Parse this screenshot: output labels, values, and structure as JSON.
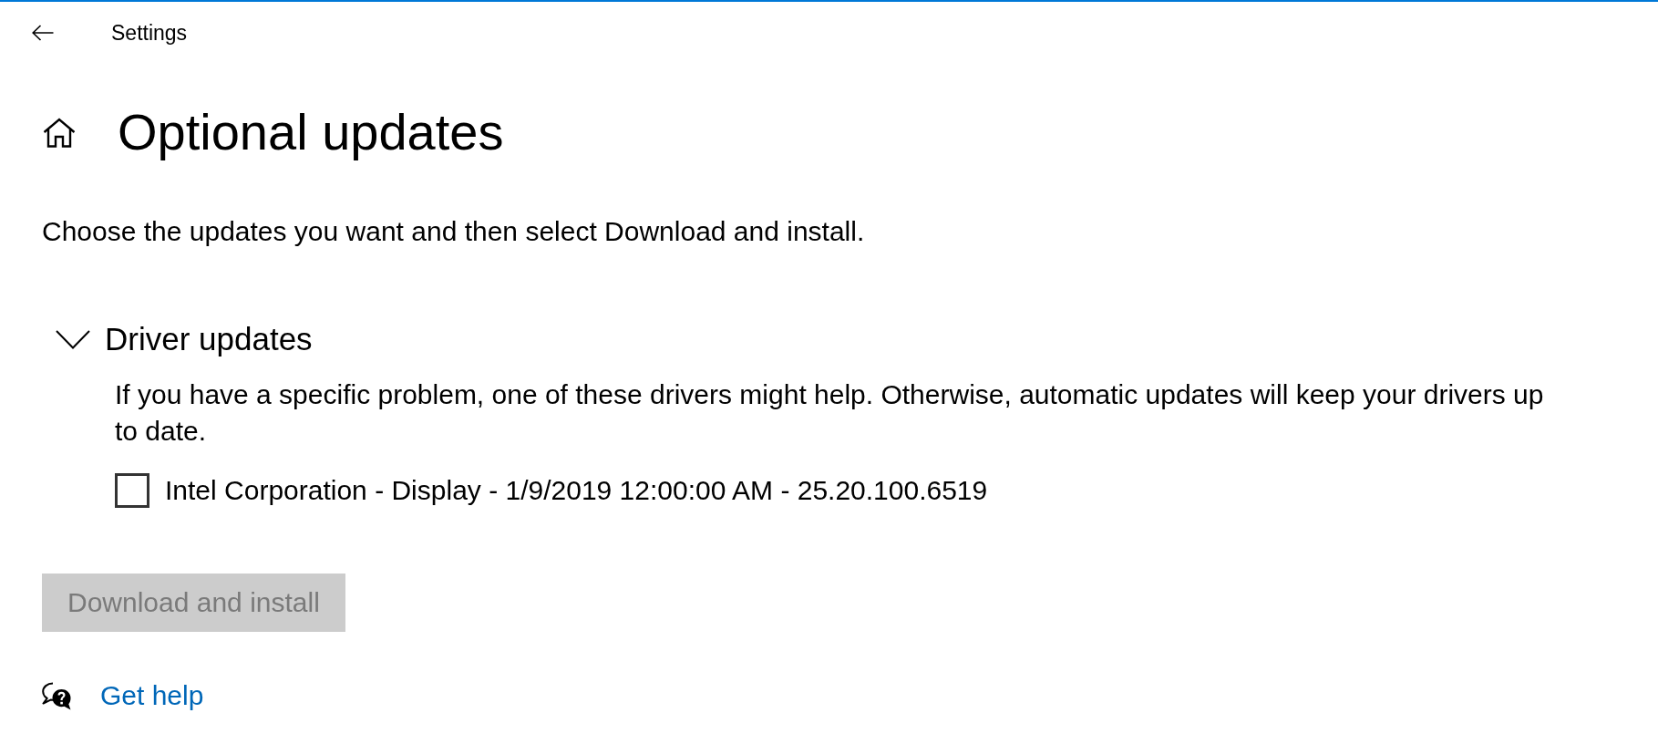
{
  "window": {
    "title": "Settings"
  },
  "page": {
    "title": "Optional updates",
    "description": "Choose the updates you want and then select Download and install."
  },
  "sections": [
    {
      "title": "Driver updates",
      "expanded": true,
      "description": "If you have a specific problem, one of these drivers might help. Otherwise, automatic updates will keep your drivers up to date.",
      "items": [
        {
          "label": "Intel Corporation - Display - 1/9/2019 12:00:00 AM - 25.20.100.6519",
          "checked": false
        }
      ]
    }
  ],
  "action_button": {
    "label": "Download and install",
    "disabled": true
  },
  "help_link": {
    "label": "Get help"
  }
}
